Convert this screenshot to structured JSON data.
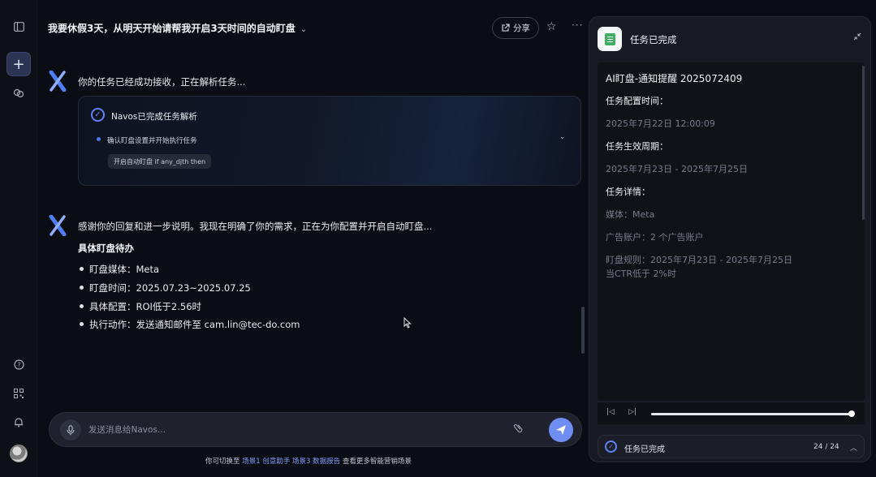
{
  "rail": {
    "icons": [
      "sidebar-toggle-icon",
      "plus-icon",
      "brain-icon",
      "help-icon",
      "qrcode-icon",
      "bell-icon",
      "avatar"
    ],
    "new_label": "+"
  },
  "header": {
    "title": "我要休假3天，从明天开始请帮我开启3天时间的自动盯盘",
    "share_label": "分享",
    "chev": "⌄",
    "star": "☆",
    "more": "···"
  },
  "messages": [
    {
      "text": "你的任务已经成功接收，正在解析任务..."
    },
    {
      "text": "感谢你的回复和进一步说明。我现在明确了你的需求，正在为你配置并开启自动盯盘..."
    }
  ],
  "task_card": {
    "title": "Navos已完成任务解析",
    "step": "确认盯盘设置并开始执行任务",
    "chip": "开启自动盯盘 if any_djth then"
  },
  "todo": {
    "title": "具体盯盘待办",
    "items": [
      "盯盘媒体：Meta",
      "盯盘时间：2025.07.23~2025.07.25",
      "具体配置：ROI低于2.56时",
      "执行动作：发送通知邮件至 cam.lin@tec-do.com"
    ]
  },
  "input": {
    "placeholder": "发送消息给Navos..."
  },
  "hint": {
    "prefix": "你可切换至 ",
    "link1": "场景1 创意助手",
    "link2": "场景3 数据报告",
    "suffix": " 查看更多智能营销场景"
  },
  "panel": {
    "title": "任务已完成",
    "doc_title": "AI盯盘-通知提醒 2025072409",
    "config_time_label": "任务配置时间：",
    "config_time_value": "2025年7月22日 12:00:09",
    "period_label": "任务生效周期：",
    "period_value": "2025年7月23日 - 2025年7月25日",
    "detail_label": "任务详情：",
    "media_value": "媒体：Meta",
    "accounts_value": "广告账户：2 个广告账户",
    "rule_value_1": "盯盘规则：2025年7月23日 - 2025年7月25日",
    "rule_value_2": "当CTR低于 2%时",
    "player": {
      "progress": 1.0
    },
    "status": {
      "text": "任务已完成",
      "count": "24 / 24"
    }
  },
  "colors": {
    "accent": "#6f8df2",
    "background": "#0b0d14",
    "panel": "#171a22",
    "doc_icon": "#3fae62"
  }
}
